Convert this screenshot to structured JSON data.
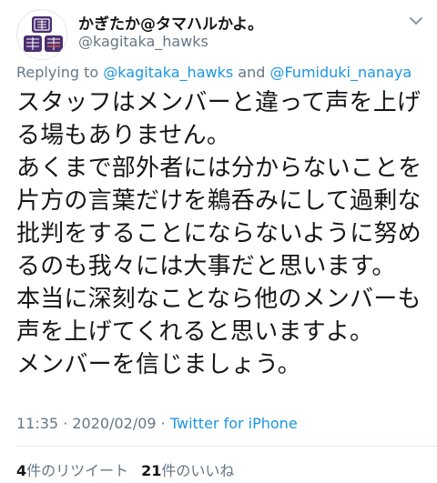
{
  "author": {
    "display_name": "かぎたか@タマハルかよ。",
    "handle": "@kagitaka_hawks",
    "avatar_icon": "team-emblem-avatar",
    "avatar_color": "#4a2e6f"
  },
  "menu": {
    "icon": "chevron-down-icon"
  },
  "reply": {
    "prefix": "Replying to ",
    "mention1": "@kagitaka_hawks",
    "conjunction": " and ",
    "mention2": "@Fumiduki_nanaya"
  },
  "tweet": {
    "lines": [
      "スタッフはメンバーと違って声を上げ",
      "る場もありません。",
      "あくまで部外者には分からないことを",
      "片方の言葉だけを鵜呑みにして過剰な",
      "批判をすることにならないように努め",
      "るのも我々には大事だと思います。",
      "本当に深刻なことなら他のメンバーも",
      "声を上げてくれると思いますよ。",
      "メンバーを信じましょう。"
    ]
  },
  "meta": {
    "time": "11:35",
    "separator1": " · ",
    "date": "2020/02/09",
    "separator2": " · ",
    "source": "Twitter for iPhone"
  },
  "stats": {
    "retweets_count": "4",
    "retweets_label": "件のリツイート",
    "likes_count": "21",
    "likes_label": "件のいいね"
  },
  "colors": {
    "accent": "#1b95e0",
    "secondary_text": "#657786",
    "primary_text": "#14171a",
    "divider": "#e1e8ed"
  }
}
